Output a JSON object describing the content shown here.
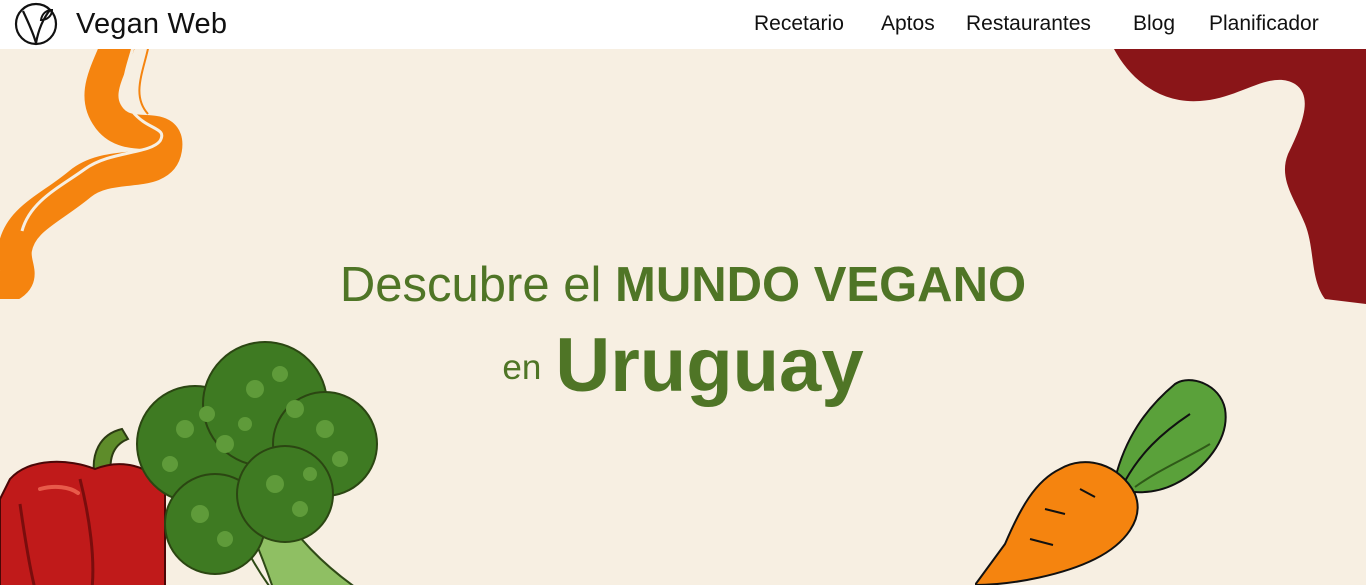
{
  "brand": {
    "name": "Vegan Web",
    "logo_icon": "leaf-v-logo-icon"
  },
  "nav": {
    "items": [
      {
        "label": "Recetario"
      },
      {
        "label": "Aptos"
      },
      {
        "label": "Restaurantes"
      },
      {
        "label": "Blog"
      },
      {
        "label": "Planificador"
      }
    ]
  },
  "hero": {
    "line1_light": "Descubre el",
    "line1_bold": "MUNDO VEGANO",
    "line2_light": "en",
    "line2_bold": "Uruguay"
  },
  "colors": {
    "background": "#f7efe2",
    "headline": "#4f7526",
    "orange_wave": "#f5840f",
    "red_blob": "#8a1518",
    "navbar": "#ffffff"
  },
  "illustrations": [
    "orange-wave-decoration",
    "red-blob-decoration",
    "red-pepper-illustration",
    "broccoli-illustration",
    "carrot-illustration"
  ]
}
